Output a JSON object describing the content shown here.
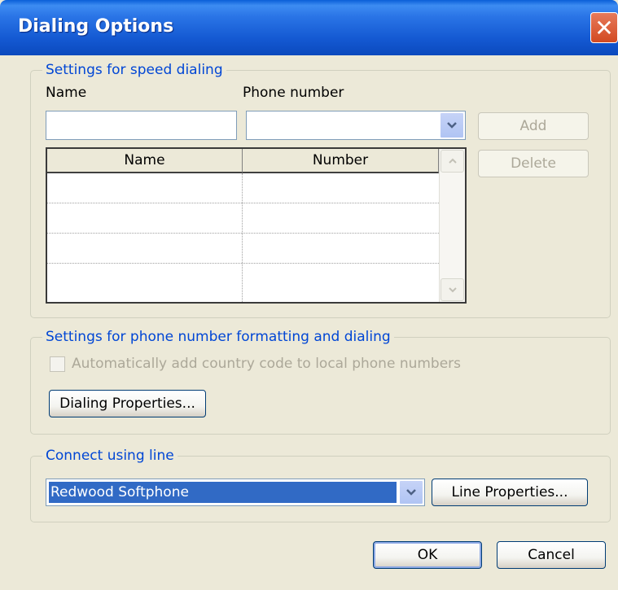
{
  "window": {
    "title": "Dialing Options",
    "close_glyph": "✕"
  },
  "speed_dialing": {
    "legend": "Settings for speed dialing",
    "name_label": "Name",
    "phone_label": "Phone number",
    "name_value": "",
    "phone_value": "",
    "add_label": "Add",
    "delete_label": "Delete",
    "table": {
      "columns": [
        "Name",
        "Number"
      ],
      "rows": [
        [
          "",
          ""
        ],
        [
          "",
          ""
        ],
        [
          "",
          ""
        ],
        [
          "",
          ""
        ]
      ]
    }
  },
  "formatting": {
    "legend": "Settings for phone number formatting and dialing",
    "auto_country_code_label": "Automatically add country code to local phone numbers",
    "auto_country_code_checked": false,
    "dialing_properties_label": "Dialing Properties..."
  },
  "connect": {
    "legend": "Connect using line",
    "line_value": "Redwood Softphone",
    "line_properties_label": "Line Properties..."
  },
  "footer": {
    "ok_label": "OK",
    "cancel_label": "Cancel"
  },
  "icons": {
    "dropdown_arrow": "chevron-down-icon",
    "scroll_up": "chevron-up-icon",
    "scroll_down": "chevron-down-icon"
  }
}
